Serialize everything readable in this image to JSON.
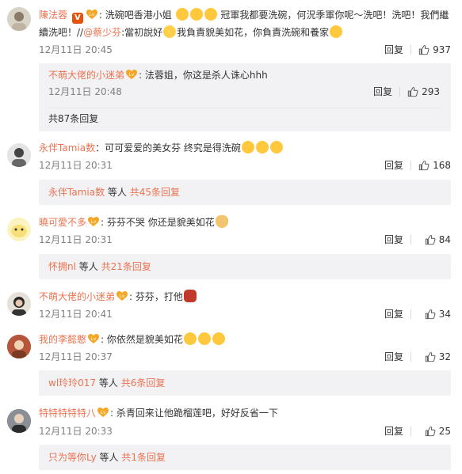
{
  "comments": [
    {
      "user": "陳法蓉",
      "text_a": "洗碗吧香港小姐",
      "text_b": "冠軍我都要洗碗，何況季軍你呢～洗吧！洗吧！我們繼續洗吧！//",
      "mention": "@蔡少芬",
      "text_c": ":當初說好",
      "text_d": "我負責貌美如花，你負責洗碗和養家",
      "date": "12月11日 20:45",
      "reply": "回复",
      "likes": "937",
      "sub": {
        "user": "不萌大佬的小迷弟",
        "text": "法蓉姐，你这是杀人诛心hhh",
        "date": "12月11日 20:48",
        "reply": "回复",
        "likes": "293",
        "more": "共87条回复"
      }
    },
    {
      "user": "永伴Tamia数",
      "text": "可可爱爱的美女芬 终究是得洗碗",
      "date": "12月11日 20:31",
      "reply": "回复",
      "likes": "168",
      "thread_user": "永伴Tamia数",
      "thread_mid": " 等人 ",
      "thread_more": "共45条回复"
    },
    {
      "user": "曉可愛不多",
      "text": "芬芬不哭 你还是貌美如花",
      "date": "12月11日 20:31",
      "reply": "回复",
      "likes": "84",
      "thread_user": "怀拥nl",
      "thread_mid": " 等人 ",
      "thread_more": "共21条回复"
    },
    {
      "user": "不萌大佬的小迷弟",
      "text": "芬芬，打他",
      "date": "12月11日 20:41",
      "reply": "回复",
      "likes": "34"
    },
    {
      "user": "我的李懿憨",
      "text": "你依然是貌美如花",
      "date": "12月11日 20:37",
      "reply": "回复",
      "likes": "32",
      "thread_user": "wl玲玲017",
      "thread_mid": " 等人 ",
      "thread_more": "共6条回复"
    },
    {
      "user": "特特特特特八",
      "text": "杀青回来让他跪榴莲吧，好好反省一下",
      "date": "12月11日 20:33",
      "reply": "回复",
      "likes": "25",
      "thread_user": "只为等你Ly",
      "thread_mid": " 等人 ",
      "thread_more": "共1条回复"
    }
  ],
  "colors": {
    "link": "#eb7350",
    "meta": "#808080",
    "subbox": "#f2f2f5"
  },
  "icons": {
    "like": "thumbs-up-icon",
    "vip": "v-badge-icon",
    "fan": "fan-badge-icon"
  }
}
